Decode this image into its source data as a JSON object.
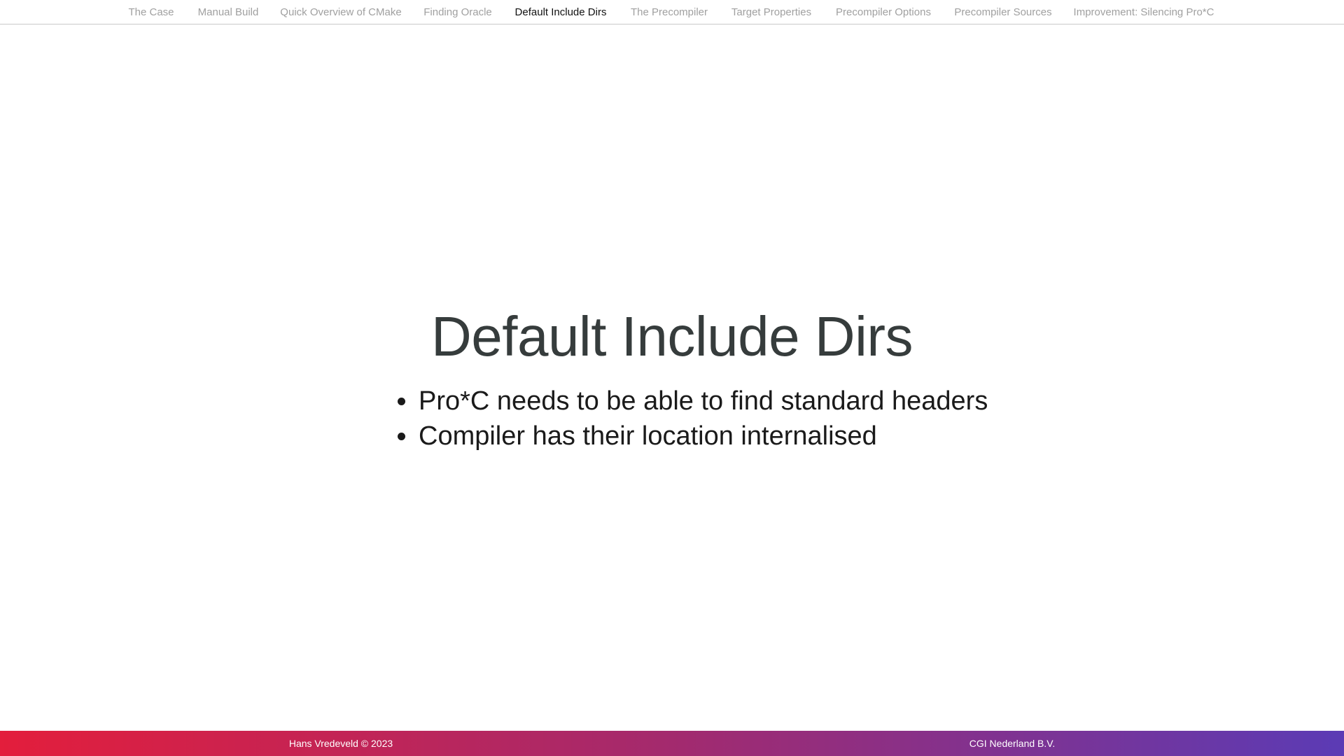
{
  "nav": {
    "items": [
      {
        "label": "The Case",
        "active": false
      },
      {
        "label": "Manual Build",
        "active": false
      },
      {
        "label": "Quick Overview of CMake",
        "active": false
      },
      {
        "label": "Finding Oracle",
        "active": false
      },
      {
        "label": "Default Include Dirs",
        "active": true
      },
      {
        "label": "The Precompiler",
        "active": false
      },
      {
        "label": "Target Properties",
        "active": false
      },
      {
        "label": "Precompiler Options",
        "active": false
      },
      {
        "label": "Precompiler Sources",
        "active": false
      },
      {
        "label": "Improvement: Silencing Pro*C",
        "active": false
      }
    ]
  },
  "slide": {
    "title": "Default Include Dirs",
    "bullets": [
      "Pro*C needs to be able to find standard headers",
      "Compiler has their location internalised"
    ]
  },
  "footer": {
    "author": "Hans Vredeveld © 2023",
    "company": "CGI Nederland B.V."
  },
  "colors": {
    "nav_inactive": "#a0a0a0",
    "nav_active": "#111111",
    "title": "#363c3c",
    "footer_gradient_start": "#e31e3c",
    "footer_gradient_end": "#5b3bb5"
  }
}
